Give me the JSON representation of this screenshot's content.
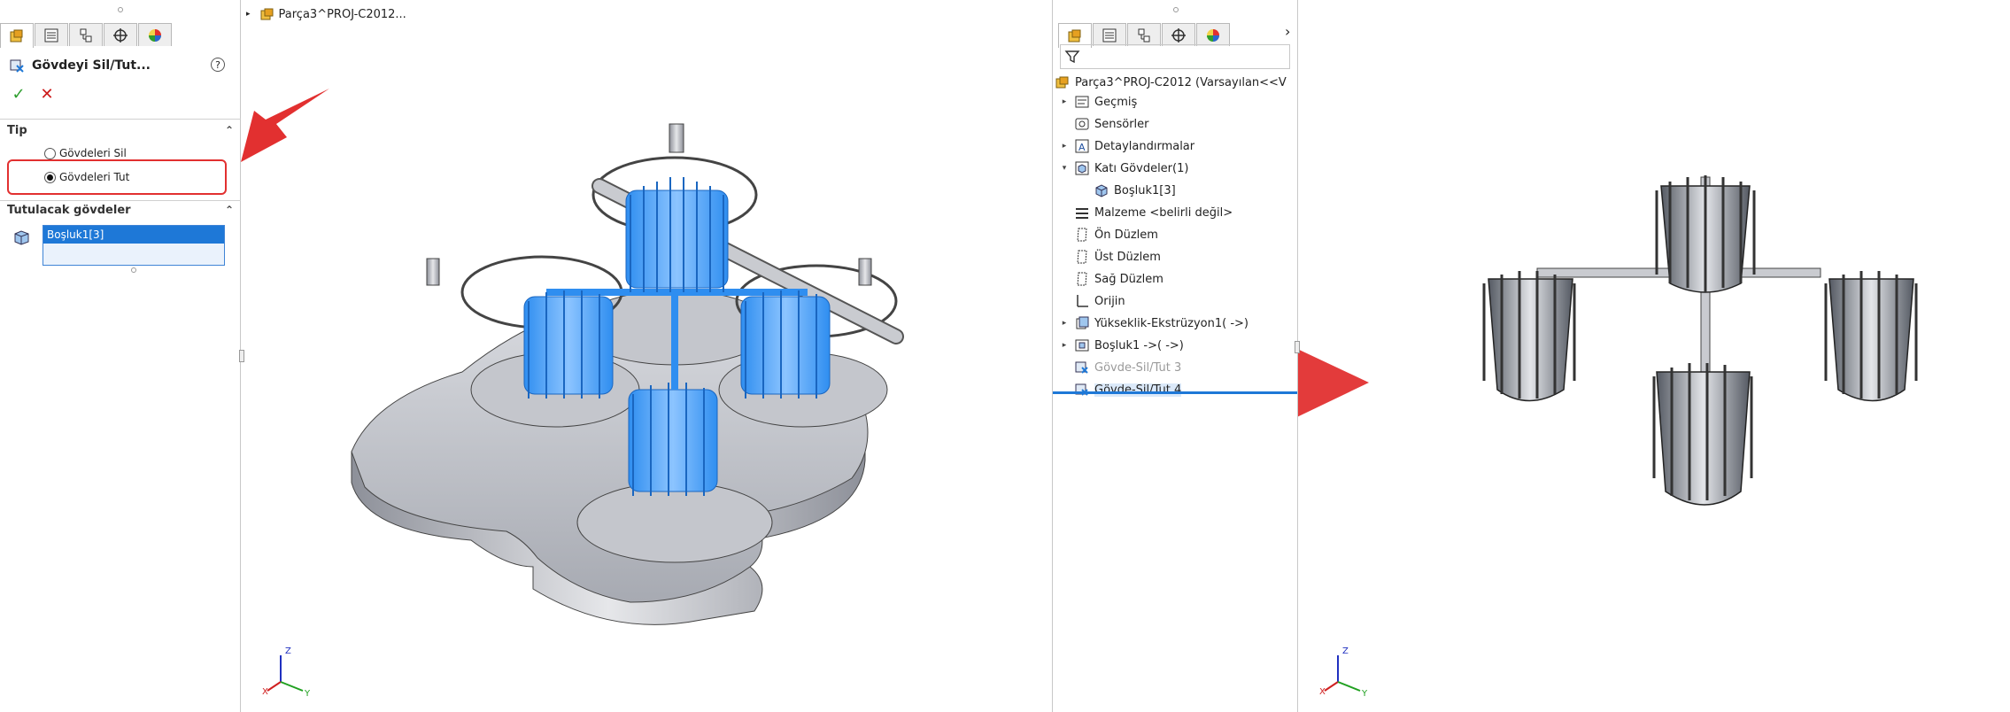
{
  "colors": {
    "accent": "#1e78d7",
    "highlight": "#e23030",
    "ok": "#2e9e2e",
    "cancel": "#cc1a1a"
  },
  "property_manager": {
    "title": "Gövdeyi Sil/Tut...",
    "help": "?",
    "ok_icon": "✓",
    "cancel_icon": "✕",
    "type_group": {
      "label": "Tip",
      "options": [
        {
          "label": "Gövdeleri Sil",
          "checked": false
        },
        {
          "label": "Gövdeleri Tut",
          "checked": true
        }
      ]
    },
    "keep_group": {
      "label": "Tutulacak gövdeler",
      "selected_item": "Boşluk1[3]"
    }
  },
  "viewport_left": {
    "breadcrumb": "Parça3^PROJ-C2012..."
  },
  "tree": {
    "root": "Parça3^PROJ-C2012  (Varsayılan<<V",
    "items": [
      {
        "label": "Geçmiş",
        "icon": "history-icon",
        "expand": "▸",
        "state": "normal"
      },
      {
        "label": "Sensörler",
        "icon": "sensor-icon",
        "expand": "",
        "state": "normal"
      },
      {
        "label": "Detaylandırmalar",
        "icon": "annotation-icon",
        "expand": "▸",
        "state": "normal"
      },
      {
        "label": "Katı Gövdeler(1)",
        "icon": "solid-bodies-icon",
        "expand": "▾",
        "state": "normal"
      },
      {
        "label": "Boşluk1[3]",
        "icon": "body-icon",
        "expand": "",
        "state": "normal"
      },
      {
        "label": "Malzeme <belirli değil>",
        "icon": "material-icon",
        "expand": "",
        "state": "normal"
      },
      {
        "label": "Ön Düzlem",
        "icon": "plane-icon",
        "expand": "",
        "state": "normal"
      },
      {
        "label": "Üst Düzlem",
        "icon": "plane-icon",
        "expand": "",
        "state": "normal"
      },
      {
        "label": "Sağ Düzlem",
        "icon": "plane-icon",
        "expand": "",
        "state": "normal"
      },
      {
        "label": "Orijin",
        "icon": "origin-icon",
        "expand": "",
        "state": "normal"
      },
      {
        "label": "Yükseklik-Ekstrüzyon1( ->)",
        "icon": "extrude-icon",
        "expand": "▸",
        "state": "normal"
      },
      {
        "label": "Boşluk1 ->( ->)",
        "icon": "cavity-icon",
        "expand": "▸",
        "state": "normal"
      },
      {
        "label": "Gövde-Sil/Tut 3",
        "icon": "body-delete-icon",
        "expand": "",
        "state": "suppressed"
      },
      {
        "label": "Gövde-Sil/Tut 4",
        "icon": "body-delete-icon",
        "expand": "",
        "state": "selected"
      }
    ]
  },
  "axes": {
    "x": "X",
    "y": "Y",
    "z": "Z"
  }
}
